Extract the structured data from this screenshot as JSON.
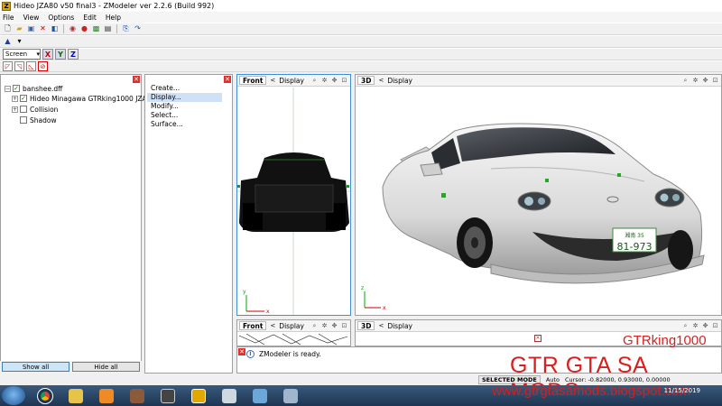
{
  "window": {
    "title": "Hideo JZA80 v50 final3 - ZModeler ver 2.2.6 (Build 992)",
    "icon_label": "Z"
  },
  "menu": [
    "File",
    "View",
    "Options",
    "Edit",
    "Help"
  ],
  "toolbar": {
    "screen_select": "Screen",
    "axis_x": "X",
    "axis_y": "Y",
    "axis_z": "Z"
  },
  "tree": {
    "items": [
      {
        "label": "banshee.dff",
        "checked": true,
        "expander": "−"
      },
      {
        "label": "Hideo Minagawa GTRking1000 JZA80",
        "checked": true,
        "expander": "+"
      },
      {
        "label": "Collision",
        "checked": false,
        "expander": "+"
      },
      {
        "label": "Shadow",
        "checked": false,
        "expander": ""
      }
    ],
    "show_all": "Show all",
    "hide_all": "Hide all"
  },
  "commands": [
    "Create...",
    "Display...",
    "Modify...",
    "Select...",
    "Surface..."
  ],
  "viewports": {
    "front": {
      "name": "Front",
      "mode": "Display"
    },
    "threed": {
      "name": "3D",
      "mode": "Display"
    },
    "front2": {
      "name": "Front",
      "mode": "Display"
    },
    "threed2": {
      "name": "3D",
      "mode": "Display"
    }
  },
  "log": {
    "message": "ZModeler is ready."
  },
  "status": {
    "mode": "SELECTED MODE",
    "auto": "Auto",
    "cursor": "Cursor: -0.82000, 0.93000, 0.00000"
  },
  "watermark": {
    "line1": "GTRking1000",
    "line2": "GTR GTA SA MODS",
    "line3": "www.gtrgtasamods.blogspot.com"
  },
  "plate": {
    "top": "湘南 35",
    "bottom": "81-973"
  },
  "clock": {
    "date": "11/15/2019"
  },
  "colors": {
    "accent_red": "#d81f1f",
    "car_body": "#e6e6e6",
    "taskbar": "#2a4566"
  }
}
